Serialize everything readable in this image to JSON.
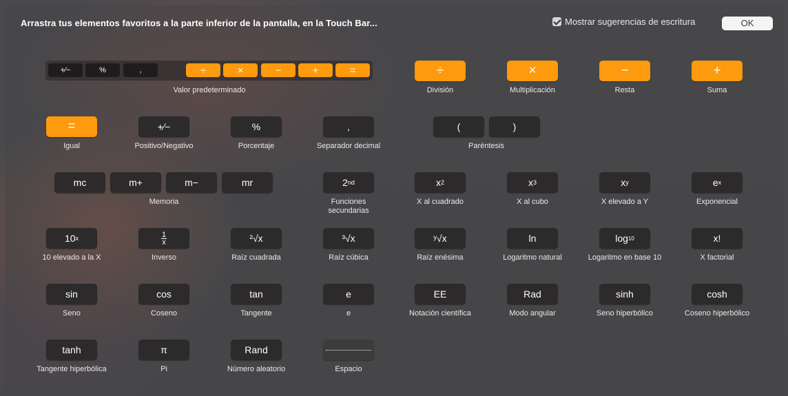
{
  "header": {
    "title": "Arrastra tus elementos favoritos a la parte inferior de la pantalla, en la Touch Bar...",
    "suggestions_label": "Mostrar sugerencias de escritura",
    "suggestions_checked": true,
    "ok_label": "OK"
  },
  "default_set": {
    "label": "Valor predeterminado",
    "keys": [
      "+∕−",
      "%",
      ",",
      "÷",
      "×",
      "−",
      "+",
      "="
    ]
  },
  "colors": {
    "accent": "#fd9a0e",
    "key": "#2c2a2a"
  },
  "items": {
    "division": {
      "key": "÷",
      "label": "División"
    },
    "multiplication": {
      "key": "×",
      "label": "Multiplicación"
    },
    "subtraction": {
      "key": "−",
      "label": "Resta"
    },
    "addition": {
      "key": "+",
      "label": "Suma"
    },
    "equal": {
      "key": "=",
      "label": "Igual"
    },
    "plus_minus": {
      "key": "+∕−",
      "label": "Positivo/Negativo"
    },
    "percent": {
      "key": "%",
      "label": "Porcentaje"
    },
    "decimal": {
      "key": ",",
      "label": "Separador decimal"
    },
    "parentheses": {
      "open": "(",
      "close": ")",
      "label": "Paréntesis"
    },
    "memory": {
      "keys": [
        "mc",
        "m+",
        "m−",
        "mr"
      ],
      "label": "Memoria"
    },
    "second": {
      "key": "2",
      "sup": "nd",
      "label": "Funciones secundarias"
    },
    "square": {
      "base": "x",
      "sup": "2",
      "label": "X al cuadrado"
    },
    "cube": {
      "base": "x",
      "sup": "3",
      "label": "X al cubo"
    },
    "power_y": {
      "base": "x",
      "sup": "y",
      "label": "X elevado a Y"
    },
    "exponential": {
      "base": "e",
      "sup": "x",
      "label": "Exponencial"
    },
    "ten_power": {
      "base": "10",
      "sup": "x",
      "label": "10 elevado a la X"
    },
    "inverse": {
      "num": "1",
      "den": "x",
      "label": "Inverso"
    },
    "sqrt": {
      "key": "²√x",
      "label": "Raíz cuadrada"
    },
    "cbrt": {
      "key": "³√x",
      "label": "Raíz cúbica"
    },
    "yroot": {
      "key": "ʸ√x",
      "label": "Raíz enésima"
    },
    "ln": {
      "key": "ln",
      "label": "Logaritmo natural"
    },
    "log10": {
      "base": "log",
      "sub": "10",
      "label": "Logaritmo en base 10"
    },
    "factorial": {
      "key": "x!",
      "label": "X factorial"
    },
    "sin": {
      "key": "sin",
      "label": "Seno"
    },
    "cos": {
      "key": "cos",
      "label": "Coseno"
    },
    "tan": {
      "key": "tan",
      "label": "Tangente"
    },
    "e": {
      "key": "e",
      "label": "e"
    },
    "ee": {
      "key": "EE",
      "label": "Notación científica"
    },
    "rad": {
      "key": "Rad",
      "label": "Modo angular"
    },
    "sinh": {
      "key": "sinh",
      "label": "Seno hiperbólico"
    },
    "cosh": {
      "key": "cosh",
      "label": "Coseno hiperbólico"
    },
    "tanh": {
      "key": "tanh",
      "label": "Tangente hiperbólica"
    },
    "pi": {
      "key": "π",
      "label": "Pi"
    },
    "rand": {
      "key": "Rand",
      "label": "Número aleatorio"
    },
    "space": {
      "label": "Espacio"
    }
  }
}
